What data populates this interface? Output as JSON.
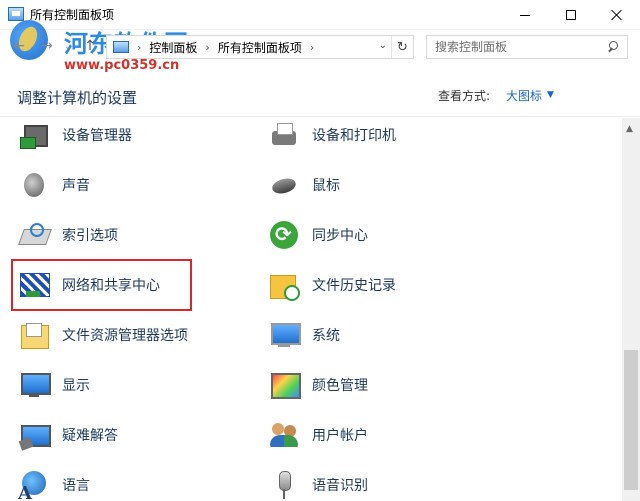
{
  "window": {
    "title": "所有控制面板项",
    "minimize_label": "",
    "maximize_label": "",
    "close_label": ""
  },
  "watermark": {
    "title": "河东软件园",
    "url": "www.pc0359.cn"
  },
  "address_bar": {
    "breadcrumb": [
      "控制面板",
      "所有控制面板项"
    ],
    "refresh_icon": "refresh-icon"
  },
  "search": {
    "placeholder": "搜索控制面板"
  },
  "header": {
    "title": "调整计算机的设置",
    "view_by_label": "查看方式:",
    "view_by_value": "大图标"
  },
  "items": [
    {
      "label": "设备管理器",
      "icon": "device-manager-icon"
    },
    {
      "label": "设备和打印机",
      "icon": "printer-icon"
    },
    {
      "label": "声音",
      "icon": "speaker-icon"
    },
    {
      "label": "鼠标",
      "icon": "mouse-icon"
    },
    {
      "label": "索引选项",
      "icon": "indexing-icon"
    },
    {
      "label": "同步中心",
      "icon": "sync-icon"
    },
    {
      "label": "网络和共享中心",
      "icon": "network-icon"
    },
    {
      "label": "文件历史记录",
      "icon": "file-history-icon"
    },
    {
      "label": "文件资源管理器选项",
      "icon": "folder-options-icon"
    },
    {
      "label": "系统",
      "icon": "system-icon"
    },
    {
      "label": "显示",
      "icon": "display-icon"
    },
    {
      "label": "颜色管理",
      "icon": "color-management-icon"
    },
    {
      "label": "疑难解答",
      "icon": "troubleshooting-icon"
    },
    {
      "label": "用户帐户",
      "icon": "user-accounts-icon"
    },
    {
      "label": "语言",
      "icon": "language-icon"
    },
    {
      "label": "语音识别",
      "icon": "speech-recognition-icon"
    }
  ],
  "highlighted_item": "网络和共享中心",
  "colors": {
    "link_text": "#1e395b",
    "accent": "#1a64c6",
    "highlight_border": "#d42a2a",
    "watermark_blue": "#2a8be0",
    "watermark_red": "#d0342c"
  }
}
